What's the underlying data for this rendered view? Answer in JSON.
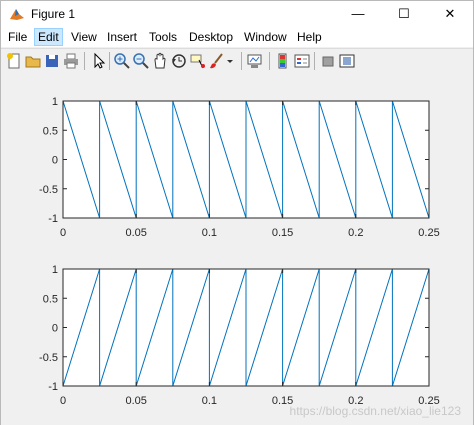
{
  "window": {
    "title": "Figure 1",
    "controls": {
      "minimize": "—",
      "maximize": "☐",
      "close": "✕"
    }
  },
  "menu": [
    {
      "label": "File"
    },
    {
      "label": "Edit"
    },
    {
      "label": "View"
    },
    {
      "label": "Insert"
    },
    {
      "label": "Tools"
    },
    {
      "label": "Desktop"
    },
    {
      "label": "Window"
    },
    {
      "label": "Help"
    }
  ],
  "toolbar": {
    "icons": [
      "new-figure-icon",
      "open-file-icon",
      "save-icon",
      "print-icon",
      "edit-plot-icon",
      "zoom-in-icon",
      "zoom-out-icon",
      "pan-icon",
      "rotate-3d-icon",
      "data-cursor-icon",
      "brush-icon",
      "brush-dropdown-icon",
      "link-plot-icon",
      "insert-colorbar-icon",
      "insert-legend-icon",
      "hide-plot-tools-icon",
      "show-plot-tools-icon"
    ]
  },
  "colors": {
    "line": "#0072bd",
    "axes_bg": "#ffffff",
    "figure_bg": "#f0f0f0"
  },
  "watermark": "https://blog.csdn.net/xiao_lie123",
  "chart_data": [
    {
      "type": "line",
      "title": "",
      "xlabel": "",
      "ylabel": "",
      "xlim": [
        0,
        0.25
      ],
      "ylim": [
        -1,
        1
      ],
      "xticks": [
        0,
        0.05,
        0.1,
        0.15,
        0.2,
        0.25
      ],
      "xticklabels": [
        "0",
        "0.05",
        "0.1",
        "0.15",
        "0.2",
        "0.25"
      ],
      "yticks": [
        1,
        0.5,
        0,
        -0.5,
        -1
      ],
      "yticklabels": [
        "1",
        "0.5",
        "0",
        "-0.5",
        "-1"
      ],
      "grid": false,
      "series": [
        {
          "x": [
            0,
            0.025,
            0.025,
            0.05,
            0.05,
            0.075,
            0.075,
            0.1,
            0.1,
            0.125,
            0.125,
            0.15,
            0.15,
            0.175,
            0.175,
            0.2,
            0.2,
            0.225,
            0.225,
            0.25,
            0.25
          ],
          "y": [
            1,
            -1,
            1,
            -1,
            1,
            -1,
            1,
            -1,
            1,
            -1,
            1,
            -1,
            1,
            -1,
            1,
            -1,
            1,
            -1,
            1,
            -1,
            1
          ]
        }
      ]
    },
    {
      "type": "line",
      "title": "",
      "xlabel": "",
      "ylabel": "",
      "xlim": [
        0,
        0.25
      ],
      "ylim": [
        -1,
        1
      ],
      "xticks": [
        0,
        0.05,
        0.1,
        0.15,
        0.2,
        0.25
      ],
      "xticklabels": [
        "0",
        "0.05",
        "0.1",
        "0.15",
        "0.2",
        "0.25"
      ],
      "yticks": [
        1,
        0.5,
        0,
        -0.5,
        -1
      ],
      "yticklabels": [
        "1",
        "0.5",
        "0",
        "-0.5",
        "-1"
      ],
      "grid": false,
      "series": [
        {
          "x": [
            0,
            0.025,
            0.025,
            0.05,
            0.05,
            0.075,
            0.075,
            0.1,
            0.1,
            0.125,
            0.125,
            0.15,
            0.15,
            0.175,
            0.175,
            0.2,
            0.2,
            0.225,
            0.225,
            0.25,
            0.25
          ],
          "y": [
            -1,
            1,
            -1,
            1,
            -1,
            1,
            -1,
            1,
            -1,
            1,
            -1,
            1,
            -1,
            1,
            -1,
            1,
            -1,
            1,
            -1,
            1,
            -1
          ]
        }
      ]
    }
  ]
}
